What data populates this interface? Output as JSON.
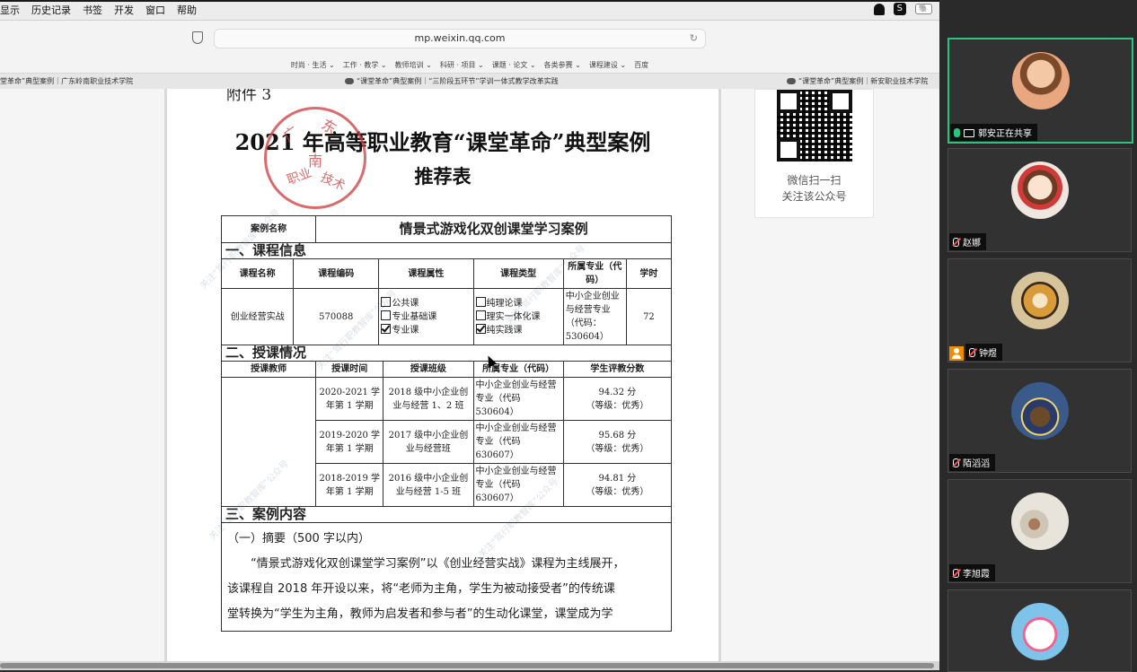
{
  "menubar": {
    "items": [
      "显示",
      "历史记录",
      "书签",
      "开发",
      "窗口",
      "帮助"
    ],
    "status_icon_label": "S",
    "battery_label": "🐘"
  },
  "browser": {
    "url": "mp.weixin.qq.com",
    "reload_glyph": "↻",
    "bookmarks": [
      "时尚 · 生活 ⌄",
      "工作 · 教学 ⌄",
      "教师培训 ⌄",
      "科研 · 项目 ⌄",
      "课题 · 论文 ⌄",
      "各类参赛 ⌄",
      "课程建设 ⌄",
      "百度"
    ],
    "tabs": [
      "堂革命”典型案例｜广东岭南职业技术学院",
      "“课堂革命”典型案例｜“三阶段五环节”学训一体式教学改革实践",
      "“课堂革命”典型案例｜新安职业技术学院"
    ]
  },
  "document": {
    "annex": "附件 3",
    "title": "2021 年高等职业教育“课堂革命”典型案例",
    "subtitle": "推荐表",
    "seal_chars": [
      "广",
      "东",
      "南",
      "职业",
      "技术"
    ],
    "case_name_label": "案例名称",
    "case_name": "情景式游戏化双创课堂学习案例",
    "sec1": "一、课程信息",
    "course_headers": [
      "课程名称",
      "课程编码",
      "课程属性",
      "课程类型",
      "所属专业（代码）",
      "学时"
    ],
    "course": {
      "name": "创业经营实战",
      "code": "570088",
      "attr": [
        "公共课",
        "专业基础课",
        "专业课"
      ],
      "type": [
        "纯理论课",
        "理实一体化课",
        "纯实践课"
      ],
      "major": "中小企业创业与经营专业（代码：530604）",
      "hours": "72"
    },
    "sec2": "二、授课情况",
    "teach_headers": [
      "授课教师",
      "授课时间",
      "授课班级",
      "所属专业（代码）",
      "学生评教分数"
    ],
    "teach_rows": [
      {
        "time": "2020-2021 学年第 1 学期",
        "class": "2018 级中小企业创业与经营 1、2 班",
        "major": "中小企业创业与经营专业（代码 530604）",
        "score": "94.32 分",
        "level": "（等级：优秀）"
      },
      {
        "time": "2019-2020 学年第 1 学期",
        "class": "2017 级中小企业创业与经营班",
        "major": "中小企业创业与经营专业（代码 630607）",
        "score": "95.68 分",
        "level": "（等级：优秀）"
      },
      {
        "time": "2018-2019 学年第 1 学期",
        "class": "2016 级中小企业创业与经营 1-5 班",
        "major": "中小企业创业与经营专业（代码 630607）",
        "score": "94.81 分",
        "level": "（等级：优秀）"
      }
    ],
    "sec3": "三、案例内容",
    "summary_heading": "（一）摘要（500 字以内）",
    "summary_lines": [
      "“情景式游戏化双创课堂学习案例”以《创业经营实战》课程为主线展开，",
      "该课程自 2018 年开设以来，将“老师为主角，学生为被动接受者”的传统课",
      "堂转换为“学生为主角，教师为启发者和参与者”的生动化课堂，课堂成为学"
    ],
    "watermark": "关注“驾行职教智库”公众号"
  },
  "wechat_card": {
    "line1": "微信扫一扫",
    "line2": "关注该公众号"
  },
  "participants": [
    {
      "name": "郭安正在共享",
      "sharing": true,
      "active": true,
      "mic": "on",
      "avatar": "girl-hands-face-avatar",
      "bg": "#e9a77f"
    },
    {
      "name": "赵娜",
      "sharing": false,
      "active": false,
      "mic": "off",
      "avatar": "cartoon-girl-avatar",
      "bg": "#f0e6e0"
    },
    {
      "name": "钟煜",
      "sharing": false,
      "active": false,
      "mic": "off",
      "host": true,
      "avatar": "tiger-avatar",
      "bg": "#d8c49a"
    },
    {
      "name": "陌滔滔",
      "sharing": false,
      "active": false,
      "mic": "off",
      "avatar": "starry-mona-lisa-avatar",
      "bg": "#3a5a8c"
    },
    {
      "name": "李旭霞",
      "sharing": false,
      "active": false,
      "mic": "off",
      "avatar": "ink-painting-avatar",
      "bg": "#e8e4dc"
    },
    {
      "name": "",
      "sharing": false,
      "active": false,
      "mic": "off",
      "avatar": "hello-kitty-avatar",
      "bg": "#7ec3ea"
    }
  ]
}
